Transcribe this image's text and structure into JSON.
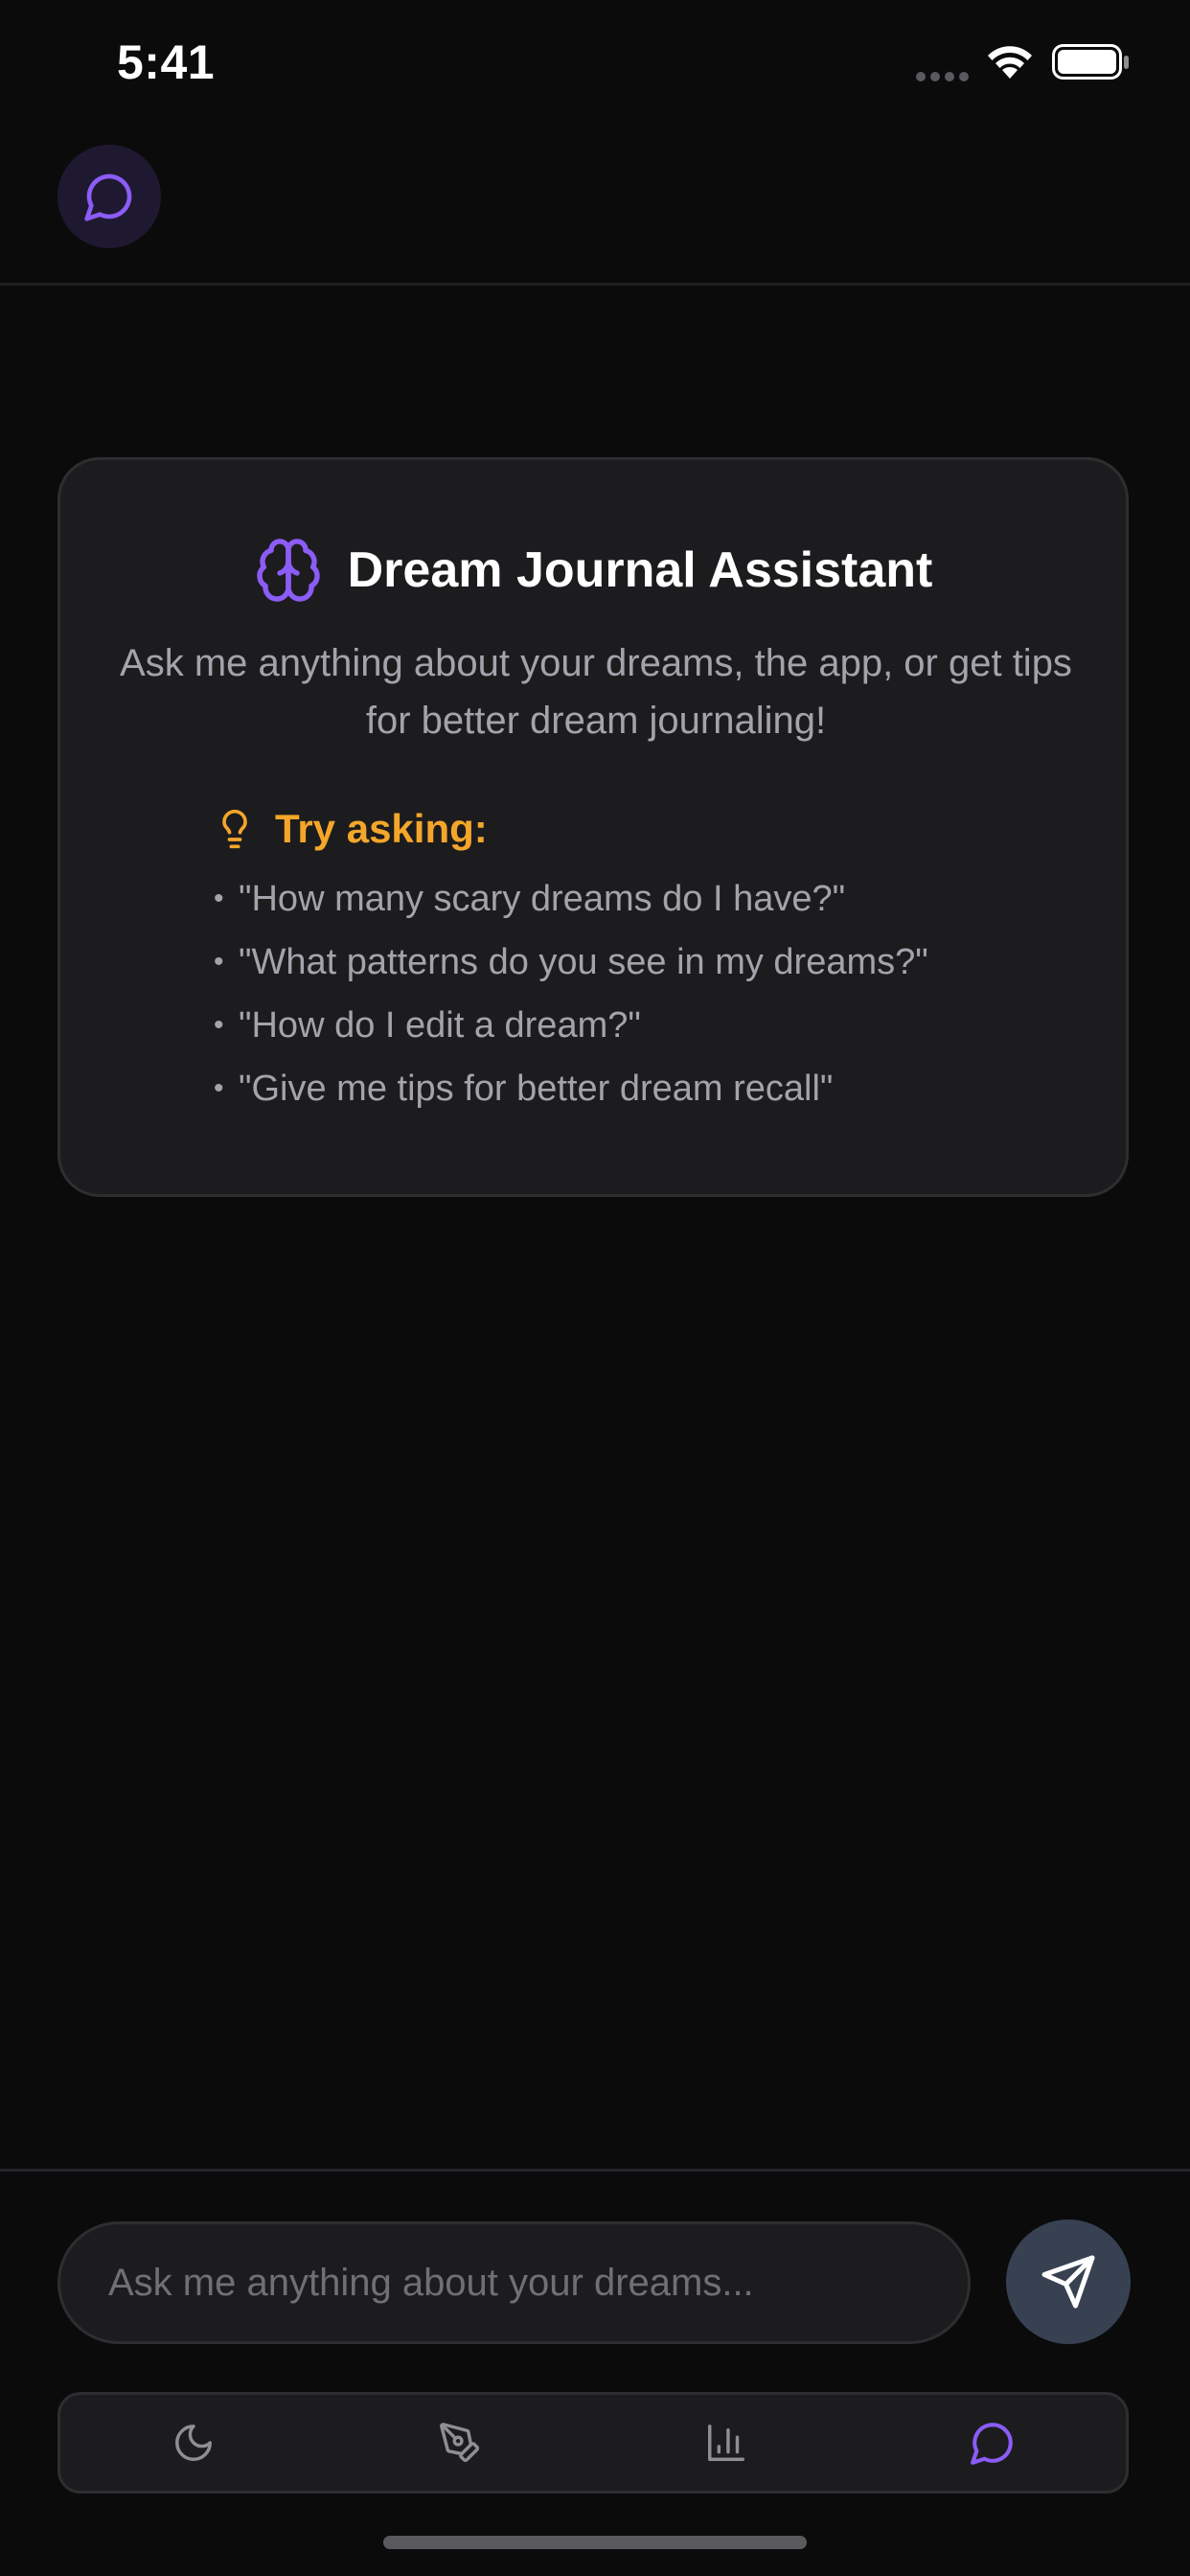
{
  "status_bar": {
    "time": "5:41"
  },
  "header": {
    "chat_icon": "message-circle-icon"
  },
  "welcome": {
    "icon": "brain-icon",
    "title": "Dream Journal Assistant",
    "subtitle": "Ask me anything about your dreams, the app, or get tips for better dream journaling!",
    "tips": {
      "icon": "lightbulb-icon",
      "title": "Try asking:",
      "items": [
        "\"How many scary dreams do I have?\"",
        "\"What patterns do you see in my dreams?\"",
        "\"How do I edit a dream?\"",
        "\"Give me tips for better dream recall\""
      ]
    }
  },
  "composer": {
    "placeholder": "Ask me anything about your dreams...",
    "value": "",
    "send_icon": "send-icon"
  },
  "tab_bar": {
    "tabs": [
      {
        "icon": "moon-icon",
        "active": false
      },
      {
        "icon": "pen-tool-icon",
        "active": false
      },
      {
        "icon": "bar-chart-icon",
        "active": false
      },
      {
        "icon": "message-circle-icon",
        "active": true
      }
    ]
  },
  "colors": {
    "background": "#0b0b0c",
    "card": "#1c1c1e",
    "accent_purple": "#8b5cf6",
    "tips_orange": "#f4a62a",
    "muted_text": "#a3a4ab",
    "send_button": "#374151",
    "inactive_tab_icon": "#8e8e93"
  }
}
